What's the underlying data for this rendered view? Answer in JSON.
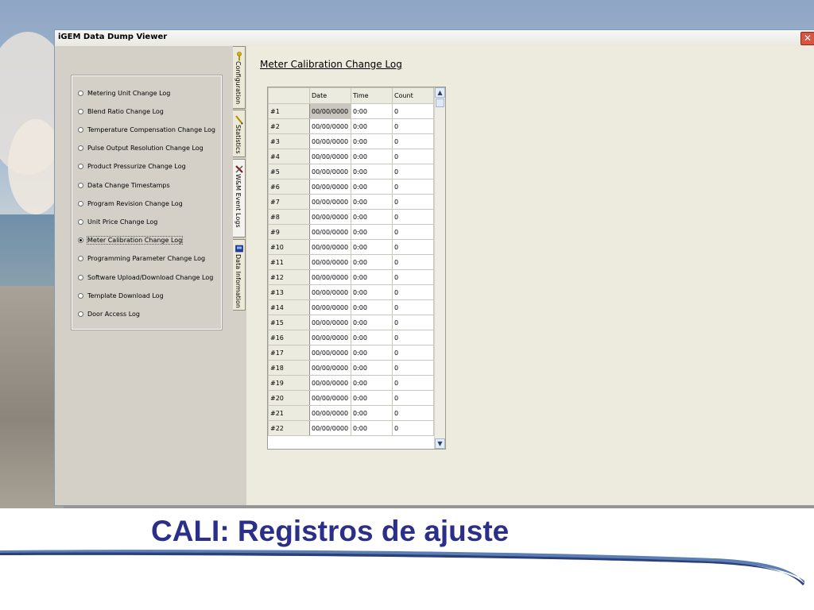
{
  "window": {
    "title": "iGEM Data Dump Viewer",
    "close_label": "✕"
  },
  "left_panel": {
    "options": [
      {
        "label": "Metering Unit Change Log",
        "selected": false
      },
      {
        "label": "Blend Ratio Change Log",
        "selected": false
      },
      {
        "label": "Temperature Compensation Change Log",
        "selected": false
      },
      {
        "label": "Pulse Output Resolution Change Log",
        "selected": false
      },
      {
        "label": "Product Pressurize Change Log",
        "selected": false
      },
      {
        "label": "Data Change Timestamps",
        "selected": false
      },
      {
        "label": "Program Revision Change Log",
        "selected": false
      },
      {
        "label": "Unit Price Change Log",
        "selected": false
      },
      {
        "label": "Meter Calibration Change Log",
        "selected": true
      },
      {
        "label": "Programming Parameter Change Log",
        "selected": false
      },
      {
        "label": "Software Upload/Download Change Log",
        "selected": false
      },
      {
        "label": "Template Download Log",
        "selected": false
      },
      {
        "label": "Door Access Log",
        "selected": false
      }
    ]
  },
  "tabs": [
    {
      "label": "Configuration",
      "icon": "key-icon",
      "active": false
    },
    {
      "label": "Statistics",
      "icon": "pencil-icon",
      "active": false
    },
    {
      "label": "W&M Event Logs",
      "icon": "tools-icon",
      "active": true
    },
    {
      "label": "Data Information",
      "icon": "monitor-icon",
      "active": false
    }
  ],
  "content": {
    "title": "Meter Calibration Change Log",
    "table": {
      "columns": [
        "",
        "Date",
        "Time",
        "Count"
      ],
      "rows": [
        [
          "#1",
          "00/00/0000",
          "0:00",
          "0"
        ],
        [
          "#2",
          "00/00/0000",
          "0:00",
          "0"
        ],
        [
          "#3",
          "00/00/0000",
          "0:00",
          "0"
        ],
        [
          "#4",
          "00/00/0000",
          "0:00",
          "0"
        ],
        [
          "#5",
          "00/00/0000",
          "0:00",
          "0"
        ],
        [
          "#6",
          "00/00/0000",
          "0:00",
          "0"
        ],
        [
          "#7",
          "00/00/0000",
          "0:00",
          "0"
        ],
        [
          "#8",
          "00/00/0000",
          "0:00",
          "0"
        ],
        [
          "#9",
          "00/00/0000",
          "0:00",
          "0"
        ],
        [
          "#10",
          "00/00/0000",
          "0:00",
          "0"
        ],
        [
          "#11",
          "00/00/0000",
          "0:00",
          "0"
        ],
        [
          "#12",
          "00/00/0000",
          "0:00",
          "0"
        ],
        [
          "#13",
          "00/00/0000",
          "0:00",
          "0"
        ],
        [
          "#14",
          "00/00/0000",
          "0:00",
          "0"
        ],
        [
          "#15",
          "00/00/0000",
          "0:00",
          "0"
        ],
        [
          "#16",
          "00/00/0000",
          "0:00",
          "0"
        ],
        [
          "#17",
          "00/00/0000",
          "0:00",
          "0"
        ],
        [
          "#18",
          "00/00/0000",
          "0:00",
          "0"
        ],
        [
          "#19",
          "00/00/0000",
          "0:00",
          "0"
        ],
        [
          "#20",
          "00/00/0000",
          "0:00",
          "0"
        ],
        [
          "#21",
          "00/00/0000",
          "0:00",
          "0"
        ],
        [
          "#22",
          "00/00/0000",
          "0:00",
          "0"
        ]
      ]
    },
    "scroll_up_label": "▲",
    "scroll_down_label": "▼"
  },
  "slide": {
    "title": "CALI: Registros de ajuste",
    "title_color": "#2c2f8a"
  }
}
